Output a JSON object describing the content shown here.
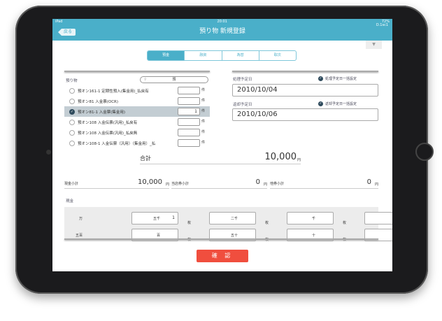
{
  "status": {
    "device": "iPad",
    "time": "20:01",
    "battery": "72%"
  },
  "nav": {
    "back": "戻る",
    "title": "預り物 新規登録",
    "id": "D.1sc1"
  },
  "tabs": [
    "預金",
    "融資",
    "為替",
    "取次"
  ],
  "left": {
    "label": "預り物",
    "search_value": "預",
    "items": [
      {
        "label": "預オン161-1 定期性預入(集金用)_払戻有",
        "qty": "",
        "selected": false
      },
      {
        "label": "預オン81 入金票(OCR)",
        "qty": "",
        "selected": false
      },
      {
        "label": "預オン81-1 入金票(集金用)",
        "qty": "1",
        "selected": true
      },
      {
        "label": "預オン108 入金伝票(汎用)_払戻有",
        "qty": "",
        "selected": false
      },
      {
        "label": "預オン108 入金伝票(汎用)_払戻無",
        "qty": "",
        "selected": false
      },
      {
        "label": "預オン108-1 入金伝票（汎用）（集金用）_払",
        "qty": "",
        "selected": false
      }
    ],
    "unit": "件"
  },
  "right": {
    "process_label": "処理予定日",
    "process_check": "処理予定日一括設定",
    "process_date": "2010/10/04",
    "return_label": "返却予定日",
    "return_check": "返却予定日一括設定",
    "return_date": "2010/10/06"
  },
  "total": {
    "label": "合計",
    "value": "10,000",
    "unit": "円"
  },
  "subtotals": [
    {
      "label": "現金小計",
      "value": "10,000",
      "unit": "円"
    },
    {
      "label": "当店券小計",
      "value": "0",
      "unit": "円"
    },
    {
      "label": "他券小計",
      "value": "0",
      "unit": "円"
    }
  ],
  "cash": {
    "label": "現金",
    "unit": "枚",
    "cells": [
      {
        "k": "万",
        "v": "1"
      },
      {
        "k": "五千",
        "v": ""
      },
      {
        "k": "二千",
        "v": ""
      },
      {
        "k": "千",
        "v": ""
      },
      {
        "k": "五百",
        "v": ""
      },
      {
        "k": "百",
        "v": ""
      },
      {
        "k": "五十",
        "v": ""
      },
      {
        "k": "十",
        "v": ""
      }
    ]
  },
  "confirm": "確 認",
  "colors": {
    "accent": "#4aafc9",
    "confirm": "#f04e3e",
    "selected_row": "#c3cdd3"
  }
}
